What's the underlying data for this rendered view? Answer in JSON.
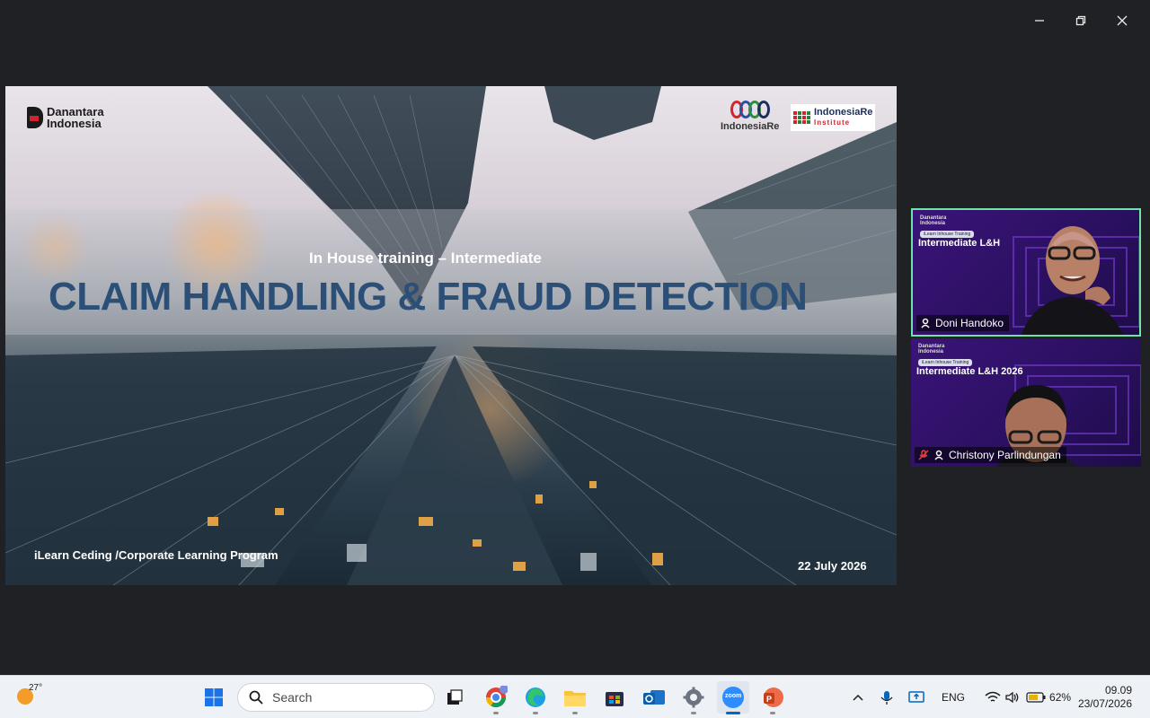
{
  "window": {
    "controls": [
      "minimize",
      "restore",
      "close"
    ]
  },
  "slide": {
    "logo_left_line1": "Danantara",
    "logo_left_line2": "Indonesia",
    "logo_ire": "IndonesiaRe",
    "logo_iri_line1": "IndonesiaRe",
    "logo_iri_line2": "Institute",
    "subtitle": "In House training – Intermediate",
    "title": "CLAIM HANDLING & FRAUD DETECTION",
    "footer_left": "iLearn Ceding /Corporate Learning Program",
    "footer_right": "22 July 2026"
  },
  "participants": [
    {
      "name": "Doni Handoko",
      "tile_title": "Intermediate L&H",
      "tile_brand_line1": "Danantara",
      "tile_brand_line2": "Indonesia",
      "tile_pill": "iLearn Inhouse Training",
      "active": true,
      "muted": false
    },
    {
      "name": "Christony Parlindungan",
      "tile_title": "Intermediate L&H 2026",
      "tile_brand_line1": "Danantara",
      "tile_brand_line2": "Indonesia",
      "tile_pill": "iLearn Inhouse Training",
      "active": false,
      "muted": true
    }
  ],
  "taskbar": {
    "weather_temp": "27°",
    "search_placeholder": "Search",
    "apps": [
      "start-icon",
      "task-view-icon",
      "chrome-icon",
      "edge-icon",
      "file-explorer-icon",
      "store-icon",
      "outlook-icon",
      "settings-icon",
      "zoom-icon",
      "powerpoint-icon"
    ],
    "active_app": "zoom-icon",
    "zoom_label": "zoom",
    "language": "ENG",
    "battery": "62%",
    "time": "09.09",
    "date": "23/07/2026"
  }
}
